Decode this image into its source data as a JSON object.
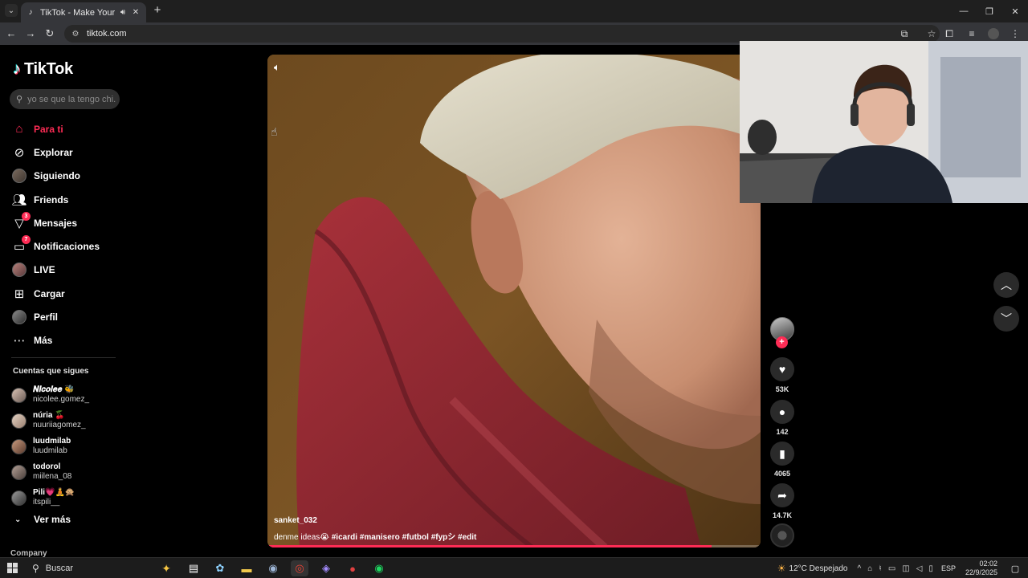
{
  "browser": {
    "tab_title": "TikTok - Make Your Day",
    "url": "tiktok.com"
  },
  "tiktok": {
    "brand": "TikTok",
    "search_placeholder": "yo se que la tengo chi...",
    "nav": [
      {
        "label": "Para ti",
        "icon": "home-icon",
        "active": true
      },
      {
        "label": "Explorar",
        "icon": "compass-icon"
      },
      {
        "label": "Siguiendo",
        "icon": "following-avatar-icon"
      },
      {
        "label": "Friends",
        "icon": "friends-icon"
      },
      {
        "label": "Mensajes",
        "icon": "messages-icon",
        "badge": "3"
      },
      {
        "label": "Notificaciones",
        "icon": "notifications-icon",
        "badge": "7"
      },
      {
        "label": "LIVE",
        "icon": "live-icon"
      },
      {
        "label": "Cargar",
        "icon": "upload-icon"
      },
      {
        "label": "Perfil",
        "icon": "profile-icon"
      },
      {
        "label": "Más",
        "icon": "more-icon"
      }
    ],
    "following_title": "Cuentas que sigues",
    "following": [
      {
        "nick": "𝑵𝒊𝒄𝒐𝒍𝒆𝒆 🐝",
        "user": "nicolee.gomez_"
      },
      {
        "nick": "núria 🍒",
        "user": "nuuriiagomez_"
      },
      {
        "nick": "luudmilab",
        "user": "luudmilab"
      },
      {
        "nick": "todorol",
        "user": "miilena_08"
      },
      {
        "nick": "Pili💗🧘🙊",
        "user": "itspili__"
      }
    ],
    "see_more": "Ver más",
    "company": "Company"
  },
  "video": {
    "username": "sanket_032",
    "caption_text": "denme ideas😭",
    "hashtags": [
      "#icardi",
      "#manisero",
      "#futbol",
      "#fypシ",
      "#edit"
    ],
    "progress": 0.9
  },
  "actions": {
    "likes": "53K",
    "comments": "142",
    "saves": "4065",
    "shares": "14.7K"
  },
  "taskbar": {
    "search_label": "Buscar",
    "weather": "12°C  Despejado",
    "lang": "ESP",
    "time": "02:02",
    "date": "22/9/2025"
  },
  "colors": {
    "accent": "#fe2c55",
    "background": "#000000",
    "browser_chrome": "#35363a"
  }
}
